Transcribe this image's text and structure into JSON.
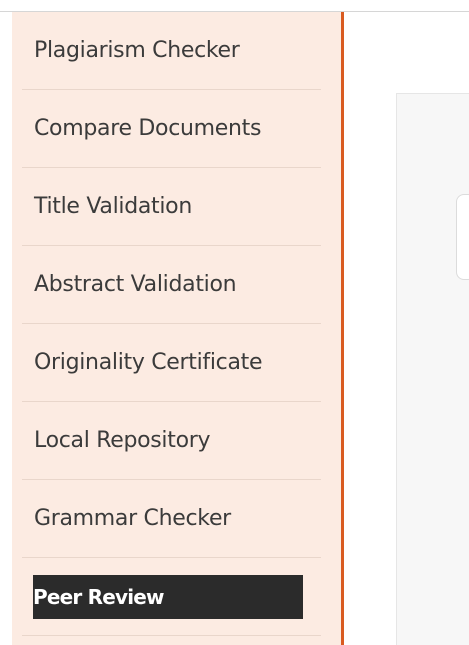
{
  "sidebar": {
    "items": [
      {
        "label": "Plagiarism Checker"
      },
      {
        "label": "Compare Documents"
      },
      {
        "label": "Title Validation"
      },
      {
        "label": "Abstract Validation"
      },
      {
        "label": "Originality Certificate"
      },
      {
        "label": "Local Repository"
      },
      {
        "label": "Grammar Checker"
      },
      {
        "label": "Peer Review",
        "active": true
      }
    ]
  },
  "colors": {
    "sidebar_bg": "#fcebe2",
    "sidebar_border": "#d95b20",
    "active_bg": "#2b2b2b",
    "active_text": "#ffffff",
    "item_text": "#3b3b3b"
  }
}
